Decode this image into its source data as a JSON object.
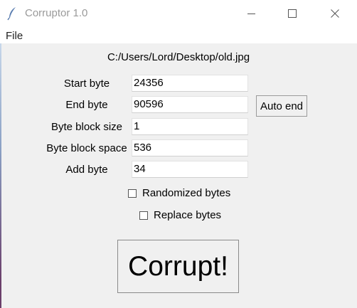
{
  "window": {
    "title": "Corruptor 1.0",
    "icon": "feather-icon"
  },
  "menu": {
    "file_label": "File"
  },
  "file_path": "C:/Users/Lord/Desktop/old.jpg",
  "fields": {
    "start_byte": {
      "label": "Start byte",
      "value": "24356"
    },
    "end_byte": {
      "label": "End byte",
      "value": "90596"
    },
    "block_size": {
      "label": "Byte block size",
      "value": "1"
    },
    "block_space": {
      "label": "Byte block space",
      "value": "536"
    },
    "add_byte": {
      "label": "Add byte",
      "value": "34"
    }
  },
  "buttons": {
    "auto_end": "Auto end",
    "corrupt": "Corrupt!"
  },
  "checkboxes": {
    "randomized": {
      "label": "Randomized bytes",
      "checked": false
    },
    "replace": {
      "label": "Replace bytes",
      "checked": false
    }
  }
}
